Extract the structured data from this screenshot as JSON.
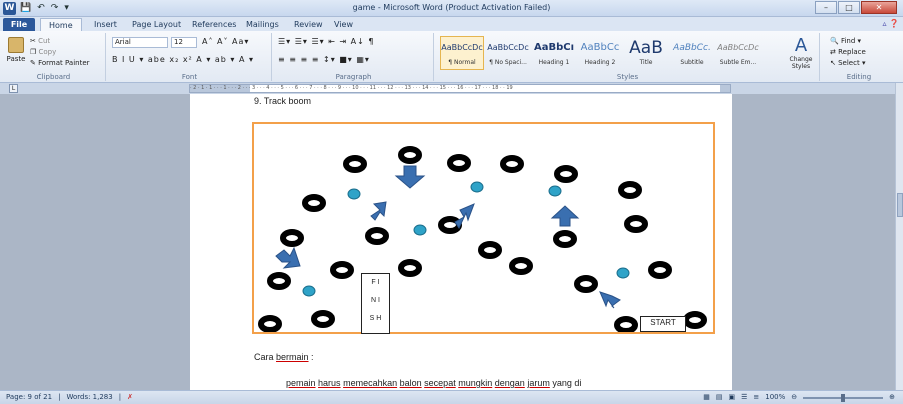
{
  "window": {
    "app_icon": "W",
    "title": "game - Microsoft Word (Product Activation Failed)",
    "qat_icons": [
      "save-icon",
      "undo-icon",
      "redo-icon",
      "customize-icon"
    ]
  },
  "tabs": [
    {
      "label": "File"
    },
    {
      "label": "Home"
    },
    {
      "label": "Insert"
    },
    {
      "label": "Page Layout"
    },
    {
      "label": "References"
    },
    {
      "label": "Mailings"
    },
    {
      "label": "Review"
    },
    {
      "label": "View"
    }
  ],
  "ribbon": {
    "clipboard": {
      "paste": "Paste",
      "cut": "Cut",
      "copy": "Copy",
      "format_painter": "Format Painter",
      "label": "Clipboard"
    },
    "font": {
      "font_name": "Arial",
      "font_size": "12",
      "row1": "A˄ A˅  Aa▾",
      "row2": "B  I  U ▾ abe x₂ x²  A ▾  ab ▾  A ▾",
      "label": "Font"
    },
    "paragraph": {
      "row1": "☰▾ ☰▾ ☰▾  ⇤ ⇥  A↓  ¶",
      "row2": "≡  ≡  ≡  ≡   ↕▾   ■▾  ▦▾",
      "label": "Paragraph"
    },
    "styles": {
      "items": [
        {
          "sample": "AaBbCcDc",
          "name": "¶ Normal"
        },
        {
          "sample": "AaBbCcDc",
          "name": "¶ No Spaci..."
        },
        {
          "sample": "AaBbCı",
          "name": "Heading 1"
        },
        {
          "sample": "AaBbCc",
          "name": "Heading 2"
        },
        {
          "sample": "AaB",
          "name": "Title"
        },
        {
          "sample": "AaBbCc.",
          "name": "Subtitle"
        },
        {
          "sample": "AaBbCcDc",
          "name": "Subtle Em..."
        }
      ],
      "change_styles": "Change Styles",
      "label": "Styles"
    },
    "editing": {
      "find": "Find",
      "replace": "Replace",
      "select": "Select",
      "label": "Editing"
    }
  },
  "ruler": {
    "corner": "L",
    "marks": "· 2 · 1 · 1 · · · 1 · · · 2 · · · 3 · · · 4 · · · 5 · · · 6 · · · 7 · · · 8 · · · 9 · · · 10 · · · 11 · · · 12 · · · 13 · · · 14 · · · 15 · · · 16 · · · 17 · · · 18 · · 19"
  },
  "document": {
    "heading": "9. Track boom",
    "finish_letters": [
      "F I",
      "N I",
      "S H"
    ],
    "start_label": "START",
    "caption_prefix": "Cara ",
    "caption_word": "bermain",
    "caption_suffix": " :",
    "body_parts": [
      {
        "t": "pemain",
        "u": true
      },
      {
        "t": " ",
        "u": false
      },
      {
        "t": "harus",
        "u": true
      },
      {
        "t": " ",
        "u": false
      },
      {
        "t": "memecahkan",
        "u": true
      },
      {
        "t": " ",
        "u": false
      },
      {
        "t": "balon",
        "u": true
      },
      {
        "t": " ",
        "u": false
      },
      {
        "t": "secepat",
        "u": true
      },
      {
        "t": " ",
        "u": false
      },
      {
        "t": "mungkin",
        "u": true
      },
      {
        "t": " ",
        "u": false
      },
      {
        "t": "dengan",
        "u": true
      },
      {
        "t": " ",
        "u": false
      },
      {
        "t": "jarum",
        "u": true
      },
      {
        "t": " yang di",
        "u": false
      }
    ]
  },
  "status": {
    "page": "Page: 9 of 21",
    "words": "Words: 1,283",
    "zoom": "100%"
  },
  "colors": {
    "frame": "#f3a04a",
    "arrow": "#3a6fb0",
    "balloon": "#2fa3c8",
    "ring": "#000000"
  }
}
